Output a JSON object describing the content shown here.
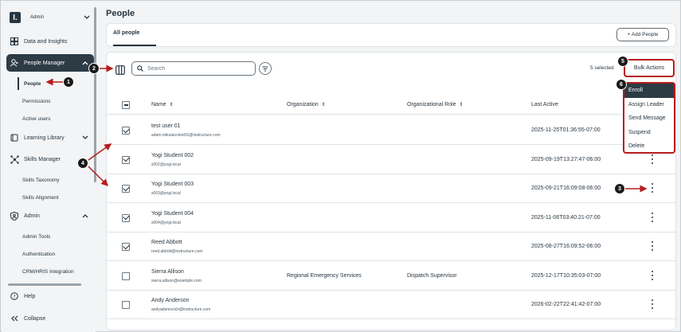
{
  "sidebar": {
    "org_name": "Admin",
    "org_logo": "I.",
    "items": [
      {
        "label": "Data and Insights",
        "icon": "dashboard-icon"
      },
      {
        "label": "People Manager",
        "icon": "person-icon"
      },
      {
        "label": "Learning Library",
        "icon": "book-icon"
      },
      {
        "label": "Skills Manager",
        "icon": "network-icon"
      },
      {
        "label": "Admin",
        "icon": "shield-icon"
      }
    ],
    "people_sub": [
      "People",
      "Permissions",
      "Active users"
    ],
    "skills_sub": [
      "Skills Taxonomy",
      "Skills Alignment"
    ],
    "admin_sub": [
      "Admin Tools",
      "Authentication",
      "CRM/HRIS Integration"
    ],
    "help_label": "Help",
    "collapse_label": "Collapse"
  },
  "page": {
    "title": "People",
    "tab_label": "All people",
    "add_button": "+ Add People"
  },
  "toolbar": {
    "search_placeholder": "Search",
    "selected_count": "5 selected",
    "bulk_actions": "Bulk Actions"
  },
  "table": {
    "columns": [
      "Name",
      "Organization",
      "Organizational Role",
      "Last Active"
    ],
    "rows": [
      {
        "name": "test user 01",
        "email": "adam.mikulas+test01@instructure.com",
        "org": "",
        "role": "",
        "last_active": "2025-11-25T01:36:55-07:00",
        "checked": true
      },
      {
        "name": "Yogi Student 002",
        "email": "s002@yogi.local",
        "org": "",
        "role": "",
        "last_active": "2025-09-19T13:27:47-06:00",
        "checked": true
      },
      {
        "name": "Yogi Student 003",
        "email": "s003@yogi.local",
        "org": "",
        "role": "",
        "last_active": "2025-09-21T16:09:08-06:00",
        "checked": true
      },
      {
        "name": "Yogi Student 004",
        "email": "s004@yogi.local",
        "org": "",
        "role": "",
        "last_active": "2025-11-06T03:40:21-07:00",
        "checked": true
      },
      {
        "name": "Reed Abbott",
        "email": "reed.abbott@instructure.com",
        "org": "",
        "role": "",
        "last_active": "2025-08-27T16:09:52-06:00",
        "checked": true
      },
      {
        "name": "Sierra Allison",
        "email": "sierra.allison@example.com",
        "org": "Regional Emergency Services",
        "role": "Dispatch Supervisor",
        "last_active": "2025-12-17T10:35:03-07:00",
        "checked": false
      },
      {
        "name": "Andy Anderson",
        "email": "andyadamovich@instructure.com",
        "org": "",
        "role": "",
        "last_active": "2026-02-22T22:41:42-07:00",
        "checked": false
      }
    ]
  },
  "bulk_menu": [
    "Enroll",
    "Assign Leader",
    "Send Message",
    "Suspend",
    "Delete"
  ],
  "callouts": [
    "1",
    "2",
    "3",
    "4",
    "5",
    "6"
  ],
  "colors": {
    "accent": "#b71c1c",
    "nav_active": "#2d3b45",
    "badge": "#1a1a1a"
  }
}
